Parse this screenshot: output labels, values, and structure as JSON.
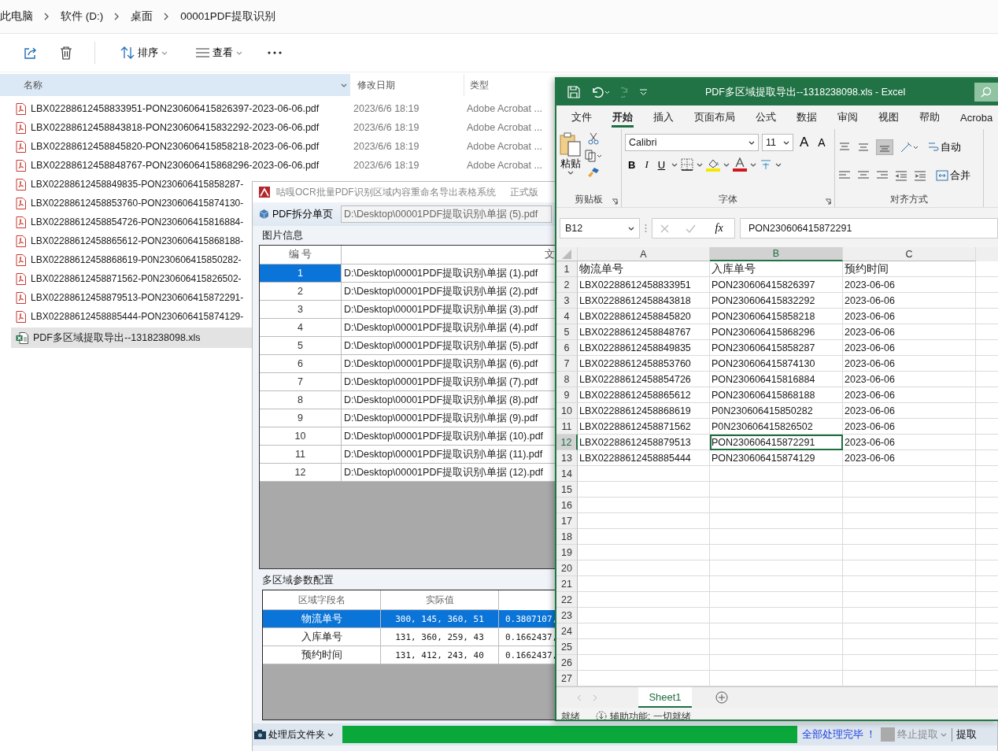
{
  "explorer": {
    "breadcrumb": [
      "此电脑",
      "软件 (D:)",
      "桌面",
      "00001PDF提取识别"
    ],
    "toolbar": {
      "sort": "排序",
      "view": "查看"
    },
    "columns": [
      "名称",
      "修改日期",
      "类型"
    ],
    "files": [
      {
        "kind": "pdf",
        "name": "LBX02288612458833951-PON230606415826397-2023-06-06.pdf",
        "date": "2023/6/6 18:19",
        "type": "Adobe Acrobat ...",
        "selected": false
      },
      {
        "kind": "pdf",
        "name": "LBX02288612458843818-PON230606415832292-2023-06-06.pdf",
        "date": "2023/6/6 18:19",
        "type": "Adobe Acrobat ...",
        "selected": false
      },
      {
        "kind": "pdf",
        "name": "LBX02288612458845820-PON230606415858218-2023-06-06.pdf",
        "date": "2023/6/6 18:19",
        "type": "Adobe Acrobat ...",
        "selected": false
      },
      {
        "kind": "pdf",
        "name": "LBX02288612458848767-PON230606415868296-2023-06-06.pdf",
        "date": "2023/6/6 18:19",
        "type": "Adobe Acrobat ...",
        "selected": false
      },
      {
        "kind": "pdf",
        "name": "LBX02288612458849835-PON230606415858287-",
        "selected": false
      },
      {
        "kind": "pdf",
        "name": "LBX02288612458853760-PON230606415874130-",
        "selected": false
      },
      {
        "kind": "pdf",
        "name": "LBX02288612458854726-PON230606415816884-",
        "selected": false
      },
      {
        "kind": "pdf",
        "name": "LBX02288612458865612-PON230606415868188-",
        "selected": false
      },
      {
        "kind": "pdf",
        "name": "LBX02288612458868619-P0N230606415850282-",
        "selected": false
      },
      {
        "kind": "pdf",
        "name": "LBX02288612458871562-P0N230606415826502-",
        "selected": false
      },
      {
        "kind": "pdf",
        "name": "LBX02288612458879513-PON230606415872291-",
        "selected": false
      },
      {
        "kind": "pdf",
        "name": "LBX02288612458885444-PON230606415874129-",
        "selected": false
      },
      {
        "kind": "xls",
        "name": "PDF多区域提取导出--1318238098.xls",
        "selected": true
      }
    ]
  },
  "ocr_app": {
    "title": "咕嘎OCR批量PDF识别区域内容重命名导出表格系统",
    "edition": "正式版",
    "split_button": "PDF拆分单页",
    "path": "D:\\Desktop\\00001PDF提取识别\\单据 (5).pdf",
    "image_group": "图片信息",
    "image_columns": [
      "编 号",
      "文"
    ],
    "images": [
      {
        "number": "1",
        "path": "D:\\Desktop\\00001PDF提取识别\\单据 (1).pdf",
        "selected": true
      },
      {
        "number": "2",
        "path": "D:\\Desktop\\00001PDF提取识别\\单据 (2).pdf",
        "selected": false
      },
      {
        "number": "3",
        "path": "D:\\Desktop\\00001PDF提取识别\\单据 (3).pdf",
        "selected": false
      },
      {
        "number": "4",
        "path": "D:\\Desktop\\00001PDF提取识别\\单据 (4).pdf",
        "selected": false
      },
      {
        "number": "5",
        "path": "D:\\Desktop\\00001PDF提取识别\\单据 (5).pdf",
        "selected": false
      },
      {
        "number": "6",
        "path": "D:\\Desktop\\00001PDF提取识别\\单据 (6).pdf",
        "selected": false
      },
      {
        "number": "7",
        "path": "D:\\Desktop\\00001PDF提取识别\\单据 (7).pdf",
        "selected": false
      },
      {
        "number": "8",
        "path": "D:\\Desktop\\00001PDF提取识别\\单据 (8).pdf",
        "selected": false
      },
      {
        "number": "9",
        "path": "D:\\Desktop\\00001PDF提取识别\\单据 (9).pdf",
        "selected": false
      },
      {
        "number": "10",
        "path": "D:\\Desktop\\00001PDF提取识别\\单据 (10).pdf",
        "selected": false
      },
      {
        "number": "11",
        "path": "D:\\Desktop\\00001PDF提取识别\\单据 (11).pdf",
        "selected": false
      },
      {
        "number": "12",
        "path": "D:\\Desktop\\00001PDF提取识别\\单据 (12).pdf",
        "selected": false
      }
    ],
    "region_group": "多区域参数配置",
    "region_columns": [
      "区域字段名",
      "实际值"
    ],
    "regions": [
      {
        "field": "物流单号",
        "value": "300, 145, 360, 51",
        "ratio": "0.3807107,",
        "selected": true
      },
      {
        "field": "入库单号",
        "value": "131, 360, 259, 43",
        "ratio": "0.1662437,",
        "selected": false
      },
      {
        "field": "预约时间",
        "value": "131, 412, 243, 40",
        "ratio": "0.1662437,",
        "selected": false
      }
    ],
    "folder_button": "处理后文件夹",
    "progress": {
      "level": 1
    },
    "status": "全部处理完毕 ！",
    "stop_button": "终止提取",
    "extract_button": "提取"
  },
  "excel": {
    "title": "PDF多区域提取导出--1318238098.xls  -  Excel",
    "tabs": [
      {
        "label": "文件",
        "selected": false
      },
      {
        "label": "开始",
        "selected": true
      },
      {
        "label": "插入",
        "selected": false
      },
      {
        "label": "页面布局",
        "selected": false
      },
      {
        "label": "公式",
        "selected": false
      },
      {
        "label": "数据",
        "selected": false
      },
      {
        "label": "审阅",
        "selected": false
      },
      {
        "label": "视图",
        "selected": false
      },
      {
        "label": "帮助",
        "selected": false
      },
      {
        "label": "Acroba",
        "selected": false
      }
    ],
    "ribbon": {
      "paste": "粘贴",
      "font": "Calibri",
      "size": "11",
      "grow": "A",
      "shrink": "A",
      "bold": "B",
      "italic": "I",
      "underline": "U",
      "wrap": "自动",
      "merge": "合并",
      "groups": [
        "剪贴板",
        "字体",
        "对齐方式"
      ]
    },
    "name_box": "B12",
    "function_label": "fx",
    "formula": "PON230606415872291",
    "columns": [
      {
        "label": "A",
        "selected": false
      },
      {
        "label": "B",
        "selected": true
      },
      {
        "label": "C",
        "selected": false
      }
    ],
    "rows": [
      {
        "number": "1",
        "selected": false,
        "cells": [
          "物流单号",
          "入库单号",
          "预约时间"
        ]
      },
      {
        "number": "2",
        "selected": false,
        "cells": [
          "LBX02288612458833951",
          "PON230606415826397",
          "2023-06-06"
        ]
      },
      {
        "number": "3",
        "selected": false,
        "cells": [
          "LBX02288612458843818",
          "PON230606415832292",
          "2023-06-06"
        ]
      },
      {
        "number": "4",
        "selected": false,
        "cells": [
          "LBX02288612458845820",
          "PON230606415858218",
          "2023-06-06"
        ]
      },
      {
        "number": "5",
        "selected": false,
        "cells": [
          "LBX02288612458848767",
          "PON230606415868296",
          "2023-06-06"
        ]
      },
      {
        "number": "6",
        "selected": false,
        "cells": [
          "LBX02288612458849835",
          "PON230606415858287",
          "2023-06-06"
        ]
      },
      {
        "number": "7",
        "selected": false,
        "cells": [
          "LBX02288612458853760",
          "PON230606415874130",
          "2023-06-06"
        ]
      },
      {
        "number": "8",
        "selected": false,
        "cells": [
          "LBX02288612458854726",
          "PON230606415816884",
          "2023-06-06"
        ]
      },
      {
        "number": "9",
        "selected": false,
        "cells": [
          "LBX02288612458865612",
          "PON230606415868188",
          "2023-06-06"
        ]
      },
      {
        "number": "10",
        "selected": false,
        "cells": [
          "LBX02288612458868619",
          "P0N230606415850282",
          "2023-06-06"
        ]
      },
      {
        "number": "11",
        "selected": false,
        "cells": [
          "LBX02288612458871562",
          "P0N230606415826502",
          "2023-06-06"
        ]
      },
      {
        "number": "12",
        "selected": true,
        "cells": [
          "LBX02288612458879513",
          "PON230606415872291",
          "2023-06-06"
        ]
      },
      {
        "number": "13",
        "selected": false,
        "cells": [
          "LBX02288612458885444",
          "PON230606415874129",
          "2023-06-06"
        ]
      },
      {
        "number": "14",
        "selected": false
      },
      {
        "number": "15",
        "selected": false
      },
      {
        "number": "16",
        "selected": false
      },
      {
        "number": "17",
        "selected": false
      },
      {
        "number": "18",
        "selected": false
      },
      {
        "number": "19",
        "selected": false
      },
      {
        "number": "20",
        "selected": false
      },
      {
        "number": "21",
        "selected": false
      },
      {
        "number": "22",
        "selected": false
      },
      {
        "number": "23",
        "selected": false
      },
      {
        "number": "24",
        "selected": false
      },
      {
        "number": "25",
        "selected": false
      },
      {
        "number": "26",
        "selected": false
      },
      {
        "number": "27",
        "selected": false
      }
    ],
    "sheets": [
      {
        "label": "Sheet1",
        "selected": true
      }
    ],
    "status": "就绪",
    "accessibility": "辅助功能: 一切就绪"
  }
}
